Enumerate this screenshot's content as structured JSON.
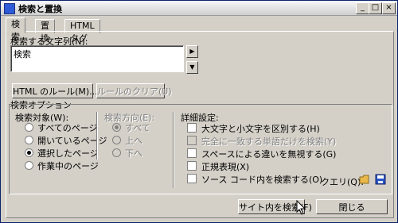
{
  "window": {
    "title": "検索と置換",
    "controls": [
      "_",
      "□",
      "×"
    ]
  },
  "tabs": [
    {
      "label": "検索",
      "active": true
    },
    {
      "label": "置換",
      "active": false
    },
    {
      "label": "HTML タグ",
      "active": false
    }
  ],
  "search": {
    "label": "検索する文字列(N):",
    "value": "検索"
  },
  "buttons": {
    "html_rule": "HTML のルール(M)...",
    "clear_rule": "ルールのクリア(U)",
    "search_site": "サイト内を検索(F)",
    "close": "閉じる"
  },
  "options": {
    "group_label": "検索オプション",
    "target": {
      "label": "検索対象(W):",
      "items": [
        {
          "label": "すべてのページ",
          "selected": false
        },
        {
          "label": "開いているページ",
          "selected": false
        },
        {
          "label": "選択したページ",
          "selected": true
        },
        {
          "label": "作業中のページ",
          "selected": false
        }
      ]
    },
    "direction": {
      "label": "検索方向(E):",
      "items": [
        {
          "label": "すべて",
          "selected": true
        },
        {
          "label": "上へ",
          "selected": false
        },
        {
          "label": "下へ",
          "selected": false
        }
      ]
    },
    "advanced": {
      "label": "詳細設定:",
      "items": [
        {
          "label": "大文字と小文字を区別する(H)",
          "checked": false,
          "disabled": false
        },
        {
          "label": "完全に一致する単語だけを検索(Y)",
          "checked": false,
          "disabled": true
        },
        {
          "label": "スペースによる違いを無視する(G)",
          "checked": false,
          "disabled": false
        },
        {
          "label": "正規表現(X)",
          "checked": false,
          "disabled": false
        },
        {
          "label": "ソース コード内を検索する(O)",
          "checked": false,
          "disabled": false
        }
      ]
    },
    "query_label": "クエリ(Q):"
  },
  "colors": {
    "open_folder": "#e8b84a",
    "save_disk": "#2a55c8"
  },
  "icons": [
    "window-icon",
    "open-folder-icon",
    "save-icon",
    "arrow-right-icon",
    "arrow-down-icon",
    "mouse-cursor-icon"
  ]
}
